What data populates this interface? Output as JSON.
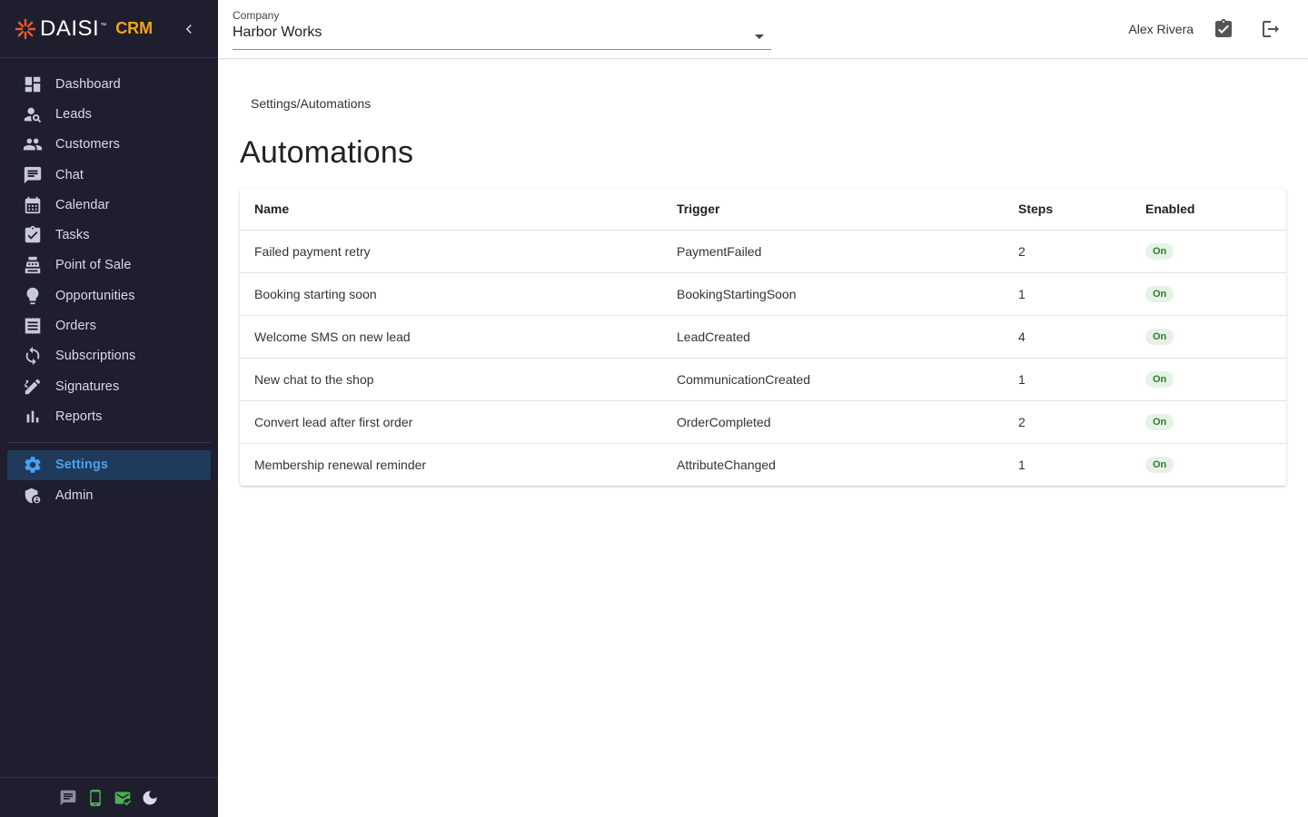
{
  "brand": {
    "logo_text": "DAISI",
    "tm": "™",
    "crm": "CRM"
  },
  "sidebar": {
    "items": [
      {
        "label": "Dashboard",
        "icon": "dashboard-icon"
      },
      {
        "label": "Leads",
        "icon": "person-search-icon"
      },
      {
        "label": "Customers",
        "icon": "people-icon"
      },
      {
        "label": "Chat",
        "icon": "chat-icon"
      },
      {
        "label": "Calendar",
        "icon": "calendar-icon"
      },
      {
        "label": "Tasks",
        "icon": "task-check-icon"
      },
      {
        "label": "Point of Sale",
        "icon": "register-icon"
      },
      {
        "label": "Opportunities",
        "icon": "lightbulb-icon"
      },
      {
        "label": "Orders",
        "icon": "receipt-icon"
      },
      {
        "label": "Subscriptions",
        "icon": "sync-icon"
      },
      {
        "label": "Signatures",
        "icon": "signature-icon"
      },
      {
        "label": "Reports",
        "icon": "bar-chart-icon"
      }
    ],
    "settings": {
      "label": "Settings",
      "icon": "gear-icon"
    },
    "admin": {
      "label": "Admin",
      "icon": "admin-shield-icon"
    },
    "footer_icons": [
      "message-icon",
      "phone-icon",
      "mail-check-icon",
      "moon-icon"
    ]
  },
  "header": {
    "company_label": "Company",
    "company_value": "Harbor Works",
    "user_name": "Alex Rivera"
  },
  "breadcrumb": "Settings/Automations",
  "page_title": "Automations",
  "table": {
    "columns": [
      "Name",
      "Trigger",
      "Steps",
      "Enabled"
    ],
    "rows": [
      {
        "name": "Failed payment retry",
        "trigger": "PaymentFailed",
        "steps": "2",
        "enabled": "On"
      },
      {
        "name": "Booking starting soon",
        "trigger": "BookingStartingSoon",
        "steps": "1",
        "enabled": "On"
      },
      {
        "name": "Welcome SMS on new lead",
        "trigger": "LeadCreated",
        "steps": "4",
        "enabled": "On"
      },
      {
        "name": "New chat to the shop",
        "trigger": "CommunicationCreated",
        "steps": "1",
        "enabled": "On"
      },
      {
        "name": "Convert lead after first order",
        "trigger": "OrderCompleted",
        "steps": "2",
        "enabled": "On"
      },
      {
        "name": "Membership renewal reminder",
        "trigger": "AttributeChanged",
        "steps": "1",
        "enabled": "On"
      }
    ]
  },
  "colors": {
    "sidebar_bg": "#1e1e2e",
    "brand_orange": "#f6a31b",
    "active_blue": "#4aa3f0",
    "badge_green": "#2e7d32"
  }
}
